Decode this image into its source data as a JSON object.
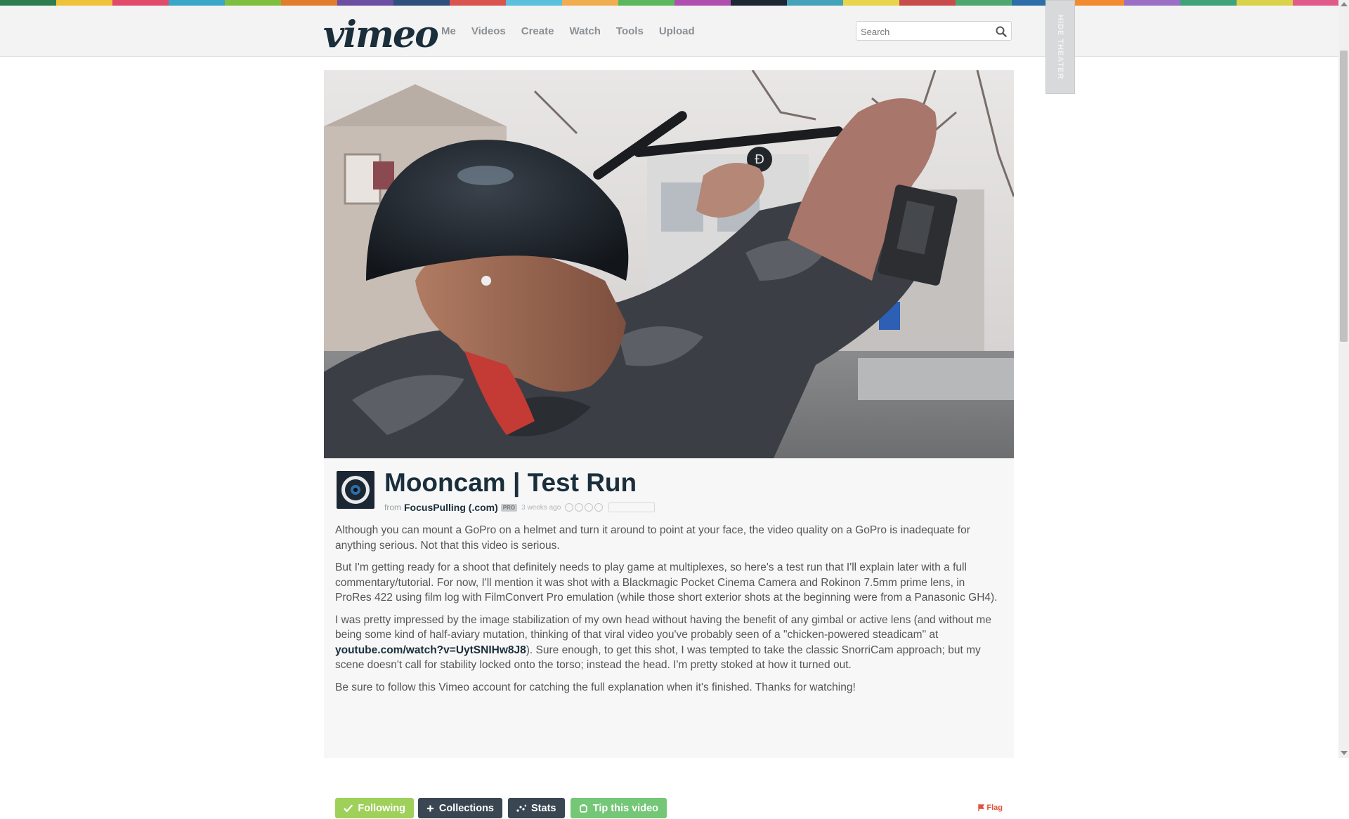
{
  "rainbow_colors": [
    "#2f7d4f",
    "#f0c23a",
    "#e24a6b",
    "#3aa6c9",
    "#7fbf3f",
    "#e37b2c",
    "#6c4ea2",
    "#2f4f7d",
    "#d9534f",
    "#5bc0de",
    "#f0ad4e",
    "#5cb85c",
    "#b04fb0",
    "#1b2733",
    "#44a3b8",
    "#e8d44d",
    "#c94c4c",
    "#4da86f",
    "#2d6ea8",
    "#f28b30",
    "#9c6fc6",
    "#3fa37a",
    "#d9d24a",
    "#e05a8a"
  ],
  "header": {
    "logo": "vimeo",
    "nav": [
      "Me",
      "Videos",
      "Create",
      "Watch",
      "Tools",
      "Upload"
    ],
    "search_placeholder": "Search"
  },
  "side_tab": {
    "label": "HIDE THEATER"
  },
  "video": {
    "title": "Mooncam | Test Run",
    "from_label": "from",
    "author": "FocusPulling (.com)",
    "badge": "PRO",
    "posted": "3 weeks ago"
  },
  "description": {
    "p1": "Although you can mount a GoPro on a helmet and turn it around to point at your face, the video quality on a GoPro is inadequate for anything serious. Not that this video is serious.",
    "p2": "But I'm getting ready for a shoot that definitely needs to play game at multiplexes, so here's a test run that I'll explain later with a full commentary/tutorial. For now, I'll mention it was shot with a Blackmagic Pocket Cinema Camera and Rokinon 7.5mm prime lens, in ProRes 422 using film log with FilmConvert Pro emulation (while those short exterior shots at the beginning were from a Panasonic GH4).",
    "p3_before": "I was pretty impressed by the image stabilization of my own head without having the benefit of any gimbal or active lens (and without me being some kind of half-aviary mutation, thinking of that viral video you've probably seen of a \"chicken-powered steadicam\" at ",
    "p3_link": "youtube.com/watch?v=UytSNIHw8J8",
    "p3_after": "). Sure enough, to get this shot, I was tempted to take the classic SnorriCam approach; but my scene doesn't call for stability locked onto the torso; instead the head. I'm pretty stoked at how it turned out.",
    "p4": "Be sure to follow this Vimeo account for catching the full explanation when it's finished. Thanks for watching!"
  },
  "actions": {
    "following": "Following",
    "collections": "Collections",
    "stats": "Stats",
    "tip": "Tip this video",
    "flag": "Flag"
  }
}
